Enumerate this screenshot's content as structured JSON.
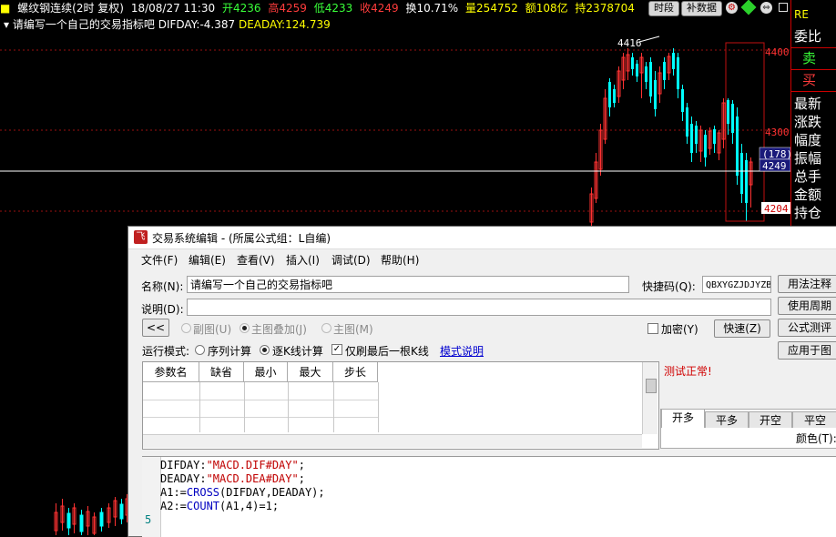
{
  "ticker": {
    "name": "螺纹钢连续(2时 复权)",
    "datetime": "18/08/27 11:30",
    "open": "开4236",
    "high": "高4259",
    "low": "低4233",
    "close": "收4249",
    "change": "换10.71%",
    "volume": "量254752",
    "amount": "额108亿",
    "hold": "持2378704",
    "btn_timeshare": "时段",
    "btn_supplement": "补数据"
  },
  "indicator_line": {
    "label": "请编写一个自己的交易指标吧",
    "dif": "DIFDAY:-4.387",
    "dea": "DEADAY:124.739"
  },
  "chart": {
    "price_labels": [
      "4400",
      "4300",
      "4204"
    ],
    "peak_label": "4416",
    "cursor_count": "(178)",
    "cursor_price": "4249",
    "colors": {
      "up": "#ff3232",
      "down": "#00ffff",
      "grid": "#9a1010",
      "highlight": "#c01010"
    }
  },
  "right_panel": {
    "top": "RE",
    "items": [
      "委比",
      "卖",
      "买",
      "最新",
      "涨跌",
      "幅度",
      "振幅",
      "总手",
      "金额",
      "持仓"
    ]
  },
  "dialog": {
    "title": "交易系统编辑 - (所属公式组：L自编)",
    "menus": [
      "文件(F)",
      "编辑(E)",
      "查看(V)",
      "插入(I)",
      "调试(D)",
      "帮助(H)"
    ],
    "name_label": "名称(N):",
    "name_value": "请编写一个自己的交易指标吧",
    "shortcut_label": "快捷码(Q):",
    "shortcut_value": "QBXYGZJDJYZB",
    "desc_label": "说明(D):",
    "desc_value": "",
    "btn_usage": "用法注释",
    "btn_period": "使用周期",
    "btn_test": "公式测评",
    "btn_apply": "应用于图",
    "collapse_btn": "<<",
    "radio_sub": "副图(U)",
    "radio_main_overlay": "主图叠加(J)",
    "radio_main": "主图(M)",
    "encrypt_label": "加密(Y)",
    "quick_btn": "快速(Z)",
    "run_mode_label": "运行模式:",
    "mode_seq": "序列计算",
    "mode_kline": "逐K线计算",
    "only_last_label": "仅刷最后一根K线",
    "mode_help_link": "模式说明",
    "test_status": "测试正常!",
    "param_headers": [
      "参数名",
      "缺省",
      "最小",
      "最大",
      "步长"
    ],
    "trade_tabs": [
      "开多",
      "平多",
      "开空",
      "平空"
    ],
    "color_label": "颜色(T):",
    "code_lines": [
      {
        "pre": "DIFDAY:",
        "s": "\"MACD.DIF#DAY\"",
        "post": ";"
      },
      {
        "pre": "DEADAY:",
        "s": "\"MACD.DEA#DAY\"",
        "post": ";"
      },
      {
        "pre": "A1:=",
        "f": "CROSS",
        "post": "(DIFDAY,DEADAY);"
      },
      {
        "pre": "A2:=",
        "f": "COUNT",
        "post": "(A1,4)=1;"
      }
    ],
    "line_number": "5"
  }
}
